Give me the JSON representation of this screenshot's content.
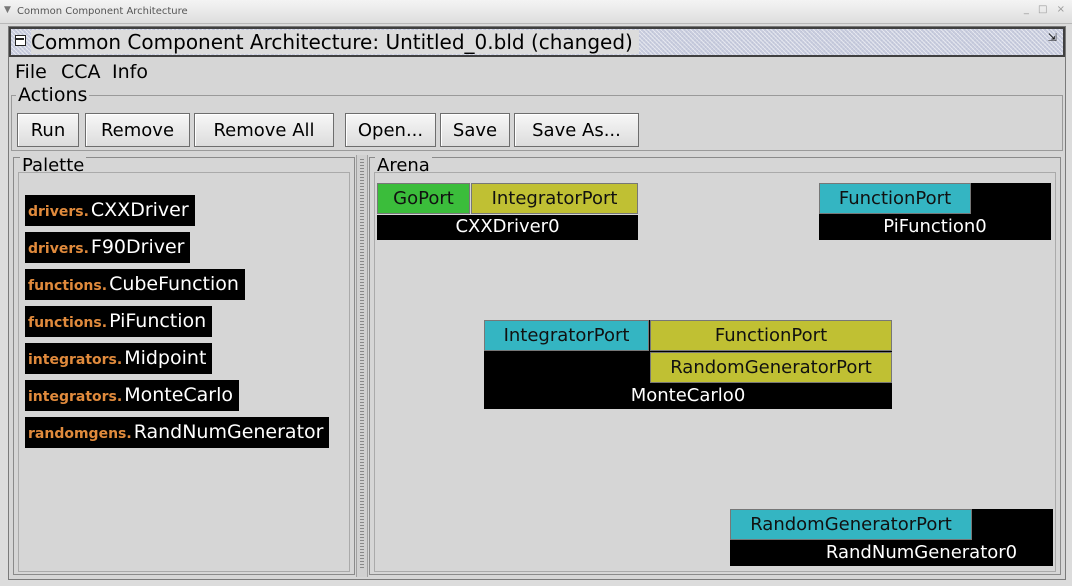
{
  "window": {
    "wm_title": "Common Component Architecture",
    "wm_menu_icon": "chevron-down-icon",
    "wm_controls": "_ □ ×"
  },
  "app": {
    "title": "Common Component Architecture: Untitled_0.bld (changed)",
    "restore_icon": "⇲"
  },
  "menu": [
    {
      "label": "File"
    },
    {
      "label": "CCA"
    },
    {
      "label": "Info"
    }
  ],
  "actions": {
    "legend": "Actions",
    "buttons": [
      {
        "label": "Run"
      },
      {
        "label": "Remove"
      },
      {
        "label": "Remove All"
      },
      {
        "label": "Open..."
      },
      {
        "label": "Save"
      },
      {
        "label": "Save As..."
      }
    ]
  },
  "palette": {
    "legend": "Palette",
    "items": [
      {
        "package": "drivers.",
        "name": "CXXDriver"
      },
      {
        "package": "drivers.",
        "name": "F90Driver"
      },
      {
        "package": "functions.",
        "name": "CubeFunction"
      },
      {
        "package": "functions.",
        "name": "PiFunction"
      },
      {
        "package": "integrators.",
        "name": "Midpoint"
      },
      {
        "package": "integrators.",
        "name": "MonteCarlo"
      },
      {
        "package": "randomgens.",
        "name": "RandNumGenerator"
      }
    ]
  },
  "arena": {
    "legend": "Arena",
    "components": [
      {
        "name": "CXXDriver0",
        "ports": [
          {
            "label": "GoPort",
            "kind": "go"
          },
          {
            "label": "IntegratorPort",
            "kind": "uses"
          }
        ]
      },
      {
        "name": "PiFunction0",
        "ports": [
          {
            "label": "FunctionPort",
            "kind": "provides"
          }
        ]
      },
      {
        "name": "MonteCarlo0",
        "ports": [
          {
            "label": "IntegratorPort",
            "kind": "provides"
          },
          {
            "label": "FunctionPort",
            "kind": "uses"
          },
          {
            "label": "RandomGeneratorPort",
            "kind": "uses"
          }
        ]
      },
      {
        "name": "RandNumGenerator0",
        "ports": [
          {
            "label": "RandomGeneratorPort",
            "kind": "provides"
          }
        ]
      }
    ]
  },
  "colors": {
    "go_port": "#3bbd3b",
    "uses_port": "#c0c033",
    "provides_port": "#34b5c2",
    "component_body": "#000000",
    "package_text": "#e08a3c"
  }
}
